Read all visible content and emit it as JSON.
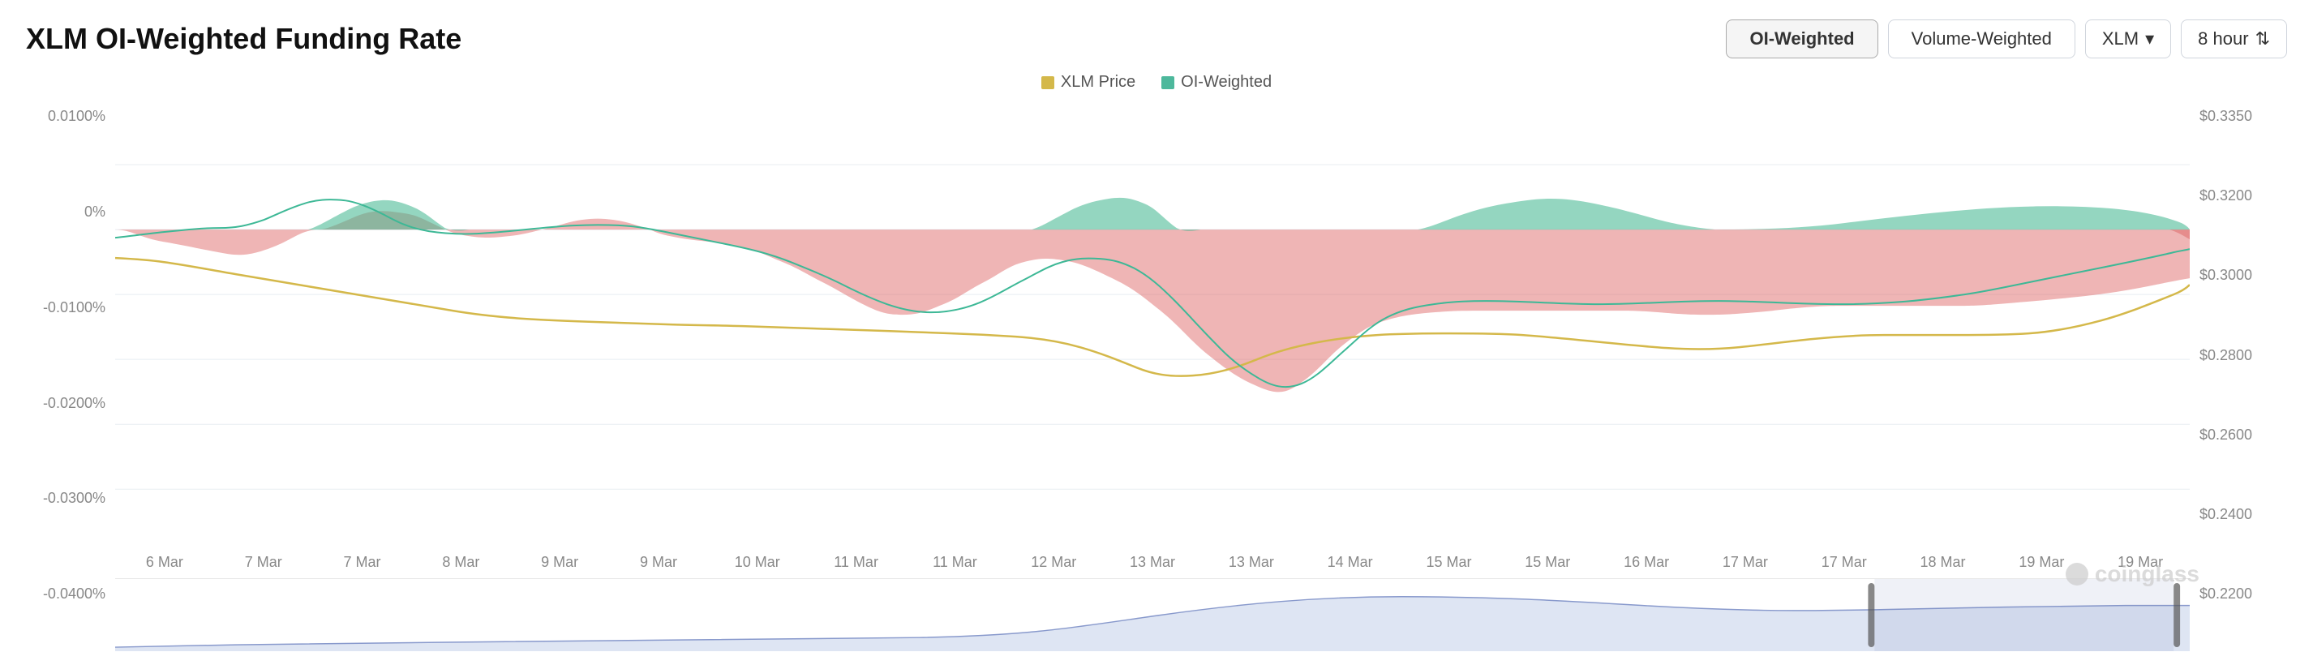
{
  "title": "XLM OI-Weighted Funding Rate",
  "controls": {
    "tab1": "OI-Weighted",
    "tab2": "Volume-Weighted",
    "asset": "XLM",
    "interval": "8 hour"
  },
  "legend": {
    "item1_label": "XLM Price",
    "item1_color": "#d4b84a",
    "item2_label": "OI-Weighted",
    "item2_color": "#4db89c"
  },
  "y_axis_left": [
    "0.0100%",
    "0%",
    "-0.0100%",
    "-0.0200%",
    "-0.0300%",
    "-0.0400%"
  ],
  "y_axis_right": [
    "$0.3350",
    "$0.3200",
    "$0.3000",
    "$0.2800",
    "$0.2600",
    "$0.2400",
    "$0.2200"
  ],
  "x_axis": [
    "6 Mar",
    "7 Mar",
    "7 Mar",
    "8 Mar",
    "9 Mar",
    "9 Mar",
    "10 Mar",
    "11 Mar",
    "11 Mar",
    "12 Mar",
    "13 Mar",
    "13 Mar",
    "14 Mar",
    "15 Mar",
    "15 Mar",
    "16 Mar",
    "17 Mar",
    "17 Mar",
    "18 Mar",
    "19 Mar",
    "19 Mar"
  ],
  "watermark": "coinglass",
  "mini_chart": {
    "description": "volume/OI mini navigator chart at bottom"
  }
}
